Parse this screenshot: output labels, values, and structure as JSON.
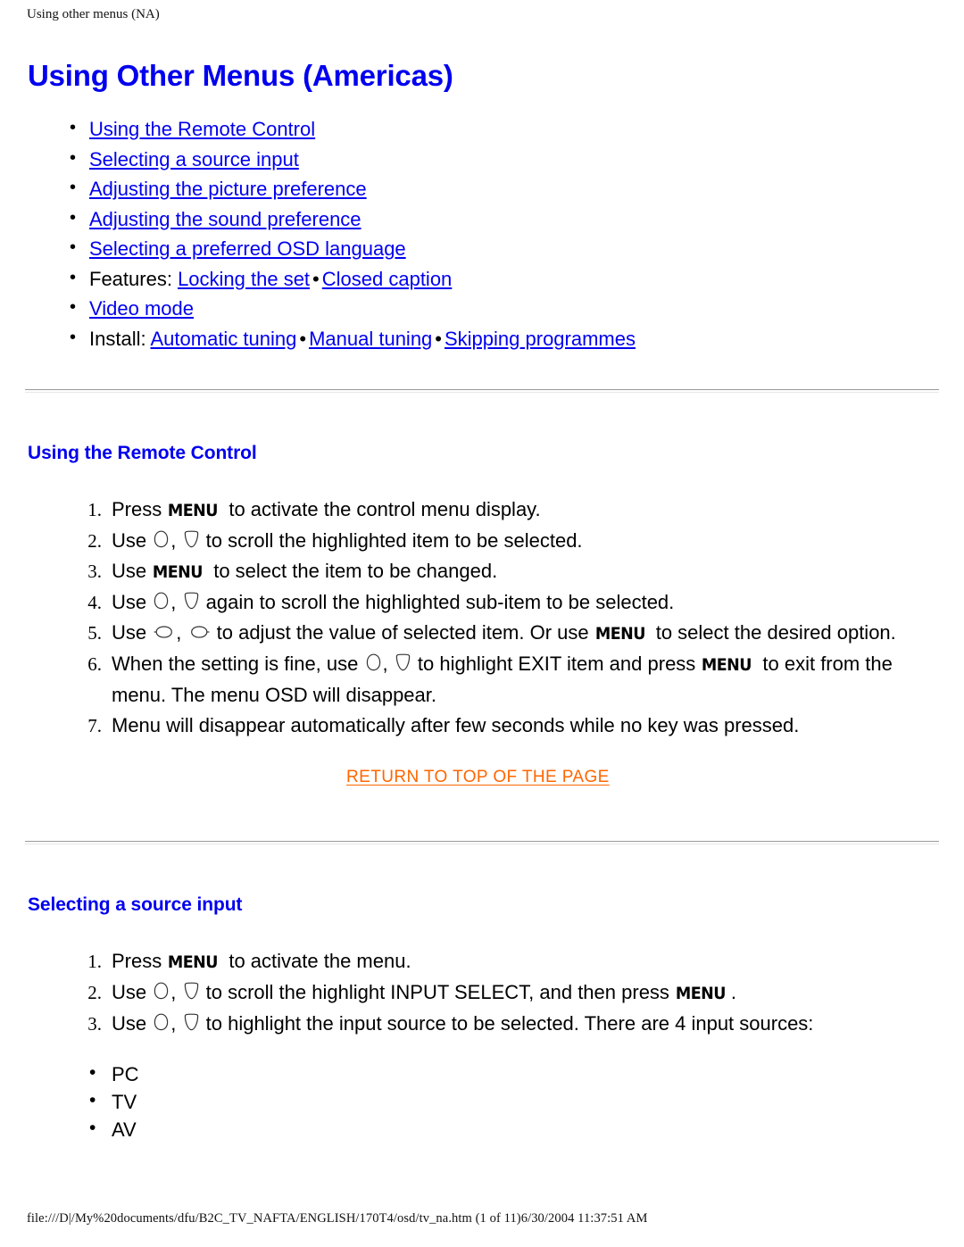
{
  "running_head": "Using other menus (NA)",
  "running_foot": "file:///D|/My%20documents/dfu/B2C_TV_NAFTA/ENGLISH/170T4/osd/tv_na.htm (1 of 11)6/30/2004 11:37:51 AM",
  "colors": {
    "link_blue": "#0000EE",
    "heading_blue": "#0000EE",
    "return_orange": "#FF6600",
    "body_black": "#000000",
    "rule_dark": "#9A9A9A",
    "rule_light": "#E8E8E8"
  },
  "title": "Using Other Menus (Americas)",
  "toc": [
    {
      "prefix": "",
      "links": [
        "Using the Remote Control"
      ],
      "separators": []
    },
    {
      "prefix": "",
      "links": [
        "Selecting a source input"
      ],
      "separators": []
    },
    {
      "prefix": "",
      "links": [
        "Adjusting the picture preference"
      ],
      "separators": []
    },
    {
      "prefix": "",
      "links": [
        "Adjusting the sound preference"
      ],
      "separators": []
    },
    {
      "prefix": "",
      "links": [
        "Selecting a preferred OSD language"
      ],
      "separators": []
    },
    {
      "prefix": "Features: ",
      "links": [
        "Locking the set",
        "Closed caption"
      ],
      "separators": [
        "•"
      ]
    },
    {
      "prefix": "",
      "links": [
        "Video mode"
      ],
      "separators": []
    },
    {
      "prefix": "Install: ",
      "links": [
        "Automatic tuning",
        "Manual tuning",
        "Skipping programmes"
      ],
      "separators": [
        "•",
        "•"
      ]
    }
  ],
  "toc_items": {
    "item0": "Using the Remote Control",
    "item1": "Selecting a source input",
    "item2": "Adjusting the picture preference",
    "item3": "Adjusting the sound preference",
    "item4": "Selecting a preferred OSD language",
    "features_label": "Features:",
    "features_link1": "Locking the set",
    "features_sep": "•",
    "features_link2": "Closed caption",
    "item6": "Video mode",
    "install_label": "Install:",
    "install_link1": "Automatic tuning",
    "install_sep1": "•",
    "install_link2": "Manual tuning",
    "install_sep2": "•",
    "install_link3": "Skipping programmes"
  },
  "section1": {
    "heading": "Using the Remote Control",
    "steps": {
      "s1a": "Press",
      "s1_menu": "MENU",
      "s1b": "to activate the control menu display.",
      "s2a": "Use",
      "s2_comma": ",",
      "s2b": "to scroll the highlighted item to be selected.",
      "s3a": "Use",
      "s3_menu": "MENU",
      "s3b": "to select the item to be changed.",
      "s4a": "Use",
      "s4_comma": ",",
      "s4b": "again to scroll the highlighted sub-item to be selected.",
      "s5a": "Use",
      "s5_comma": ",",
      "s5b": "to adjust the value of selected item. Or use",
      "s5_menu": "MENU",
      "s5c": "to select the desired option.",
      "s6a": "When the setting is fine, use",
      "s6_comma": ",",
      "s6b": "to highlight EXIT item and press",
      "s6_menu": "MENU",
      "s6c": "to exit from the menu. The menu OSD will disappear.",
      "s7": "Menu will disappear automatically after few seconds while no key was pressed."
    },
    "return_to_top": "RETURN TO TOP OF THE PAGE"
  },
  "section2": {
    "heading": "Selecting a source input",
    "steps": {
      "s1a": "Press",
      "s1_menu": "MENU",
      "s1b": "to activate the menu.",
      "s2a": "Use",
      "s2_comma": ",",
      "s2b": "to scroll the highlight INPUT SELECT, and then press",
      "s2_menu": "MENU",
      "s2c": ".",
      "s3a": "Use",
      "s3_comma": ",",
      "s3b": "to highlight the input source to be selected. There are 4 input sources:"
    },
    "sources": {
      "src0": "PC",
      "src1": "TV",
      "src2": "AV"
    }
  }
}
